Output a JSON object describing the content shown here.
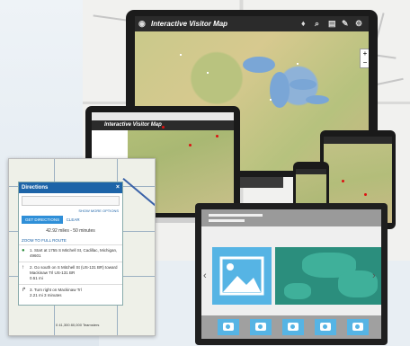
{
  "monitor": {
    "title": "Interactive Visitor Map",
    "toolbar_icons": [
      "drop-icon",
      "search-icon",
      "layers-icon",
      "tools-icon",
      "gear-icon"
    ],
    "zoom_in": "+",
    "zoom_out": "−"
  },
  "laptop": {
    "title": "Interactive Visitor Map"
  },
  "directions": {
    "title": "Directions",
    "close": "×",
    "show_more": "SHOW MORE OPTIONS",
    "get_button": "GET DIRECTIONS",
    "clear": "CLEAR",
    "distance": "42.92 miles - 50 minutes",
    "zoom_route": "ZOOM TO FULL ROUTE",
    "steps": [
      {
        "icon": "pin-icon",
        "text": "1. Start at 1755 S Mitchell St, Cadillac, Michigan, 49601"
      },
      {
        "icon": "arrow-icon",
        "text": "2. Go south on S Mitchell St (US-131 BR) toward Mackinaw Trl US-131 BR",
        "sub": "0.51 mi"
      },
      {
        "icon": "turn-right-icon",
        "text": "3. Turn right on Mackinaw Trl",
        "sub": "2.21 mi  3 minutes"
      }
    ],
    "scale": "0   41,300  80,000 Teamsters",
    "credit": "U.S. Forest Service, Ma..."
  },
  "wireframe": {
    "prev": "‹",
    "next": "›"
  },
  "colors": {
    "accent": "#1d64a8",
    "button": "#2f8fd8",
    "wireframe_blue": "#56b4e4",
    "wireframe_green": "#2b8e7d"
  }
}
